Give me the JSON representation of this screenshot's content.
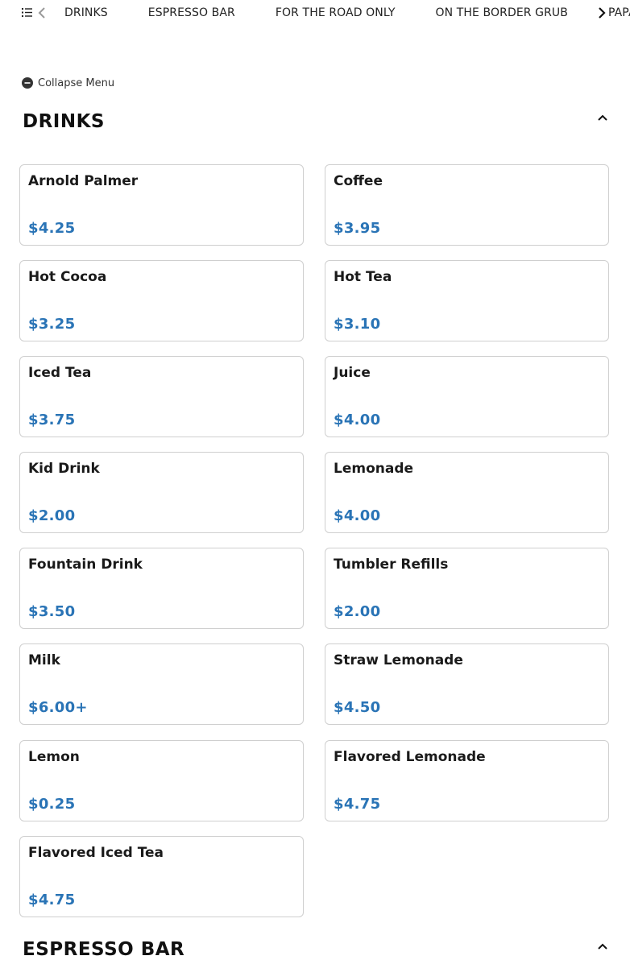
{
  "nav": {
    "list_icon": "list-icon",
    "prev_icon": "chevron-left-icon",
    "next_icon": "chevron-right-icon",
    "tabs": [
      "DRINKS",
      "ESPRESSO BAR",
      "FOR THE ROAD ONLY",
      "ON THE BORDER GRUB",
      "PAPA"
    ]
  },
  "collapse_menu": {
    "label": "Collapse Menu",
    "icon": "minus-circle-icon"
  },
  "sections": [
    {
      "title": "DRINKS",
      "toggle_icon": "chevron-up-icon",
      "items": [
        {
          "name": "Arnold Palmer",
          "price": "$4.25"
        },
        {
          "name": "Coffee",
          "price": "$3.95"
        },
        {
          "name": "Hot Cocoa",
          "price": "$3.25"
        },
        {
          "name": "Hot Tea",
          "price": "$3.10"
        },
        {
          "name": "Iced Tea",
          "price": "$3.75"
        },
        {
          "name": "Juice",
          "price": "$4.00"
        },
        {
          "name": "Kid Drink",
          "price": "$2.00"
        },
        {
          "name": "Lemonade",
          "price": "$4.00"
        },
        {
          "name": "Fountain Drink",
          "price": "$3.50"
        },
        {
          "name": "Tumbler Refills",
          "price": "$2.00"
        },
        {
          "name": "Milk",
          "price": "$6.00+"
        },
        {
          "name": "Straw Lemonade",
          "price": "$4.50"
        },
        {
          "name": "Lemon",
          "price": "$0.25"
        },
        {
          "name": "Flavored Lemonade",
          "price": "$4.75"
        },
        {
          "name": "Flavored Iced Tea",
          "price": "$4.75"
        }
      ]
    },
    {
      "title": "ESPRESSO BAR",
      "toggle_icon": "chevron-up-icon",
      "items": []
    }
  ],
  "colors": {
    "price": "#2a74b6",
    "card_border": "#cfcfcf",
    "text": "#1a1a1a"
  }
}
